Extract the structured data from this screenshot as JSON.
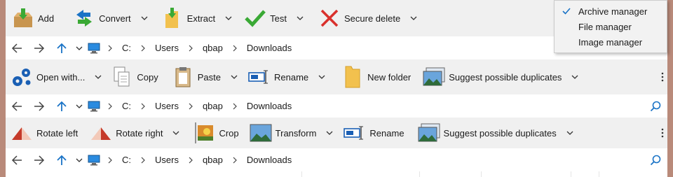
{
  "archive_toolbar": {
    "add": "Add",
    "convert": "Convert",
    "extract": "Extract",
    "test": "Test",
    "secure_delete": "Secure delete"
  },
  "file_toolbar": {
    "open_with": "Open with...",
    "copy": "Copy",
    "paste": "Paste",
    "rename": "Rename",
    "new_folder": "New folder",
    "suggest_duplicates": "Suggest possible duplicates"
  },
  "image_toolbar": {
    "rotate_left": "Rotate left",
    "rotate_right": "Rotate right",
    "crop": "Crop",
    "transform": "Transform",
    "rename": "Rename",
    "suggest_duplicates": "Suggest possible duplicates"
  },
  "address": {
    "drive": "C:",
    "folder1": "Users",
    "folder2": "qbap",
    "folder3": "Downloads"
  },
  "menu": {
    "archive_manager": "Archive manager",
    "file_manager": "File manager",
    "image_manager": "Image manager",
    "checked": "Archive manager"
  },
  "colors": {
    "toolbar_bg": "#f0f0f0",
    "accent_blue": "#1a73c6",
    "check_green": "#3aa935",
    "delete_red": "#d9302c",
    "folder_yellow": "#f2c14e"
  }
}
